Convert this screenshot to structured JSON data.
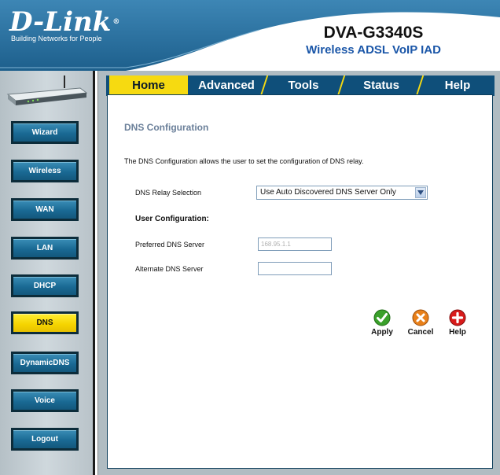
{
  "header": {
    "brand": "D-Link",
    "brand_mark": "®",
    "tagline": "Building Networks for People",
    "model": "DVA-G3340S",
    "model_desc": "Wireless ADSL VoIP IAD",
    "colors": {
      "header_blue": "#2a6e9c",
      "dark_blue": "#0f4f7a",
      "accent_yellow": "#f6da11"
    }
  },
  "sidebar": {
    "image": "router-image",
    "items": [
      {
        "label": "Wizard",
        "active": false
      },
      {
        "label": "Wireless",
        "active": false
      },
      {
        "label": "WAN",
        "active": false
      },
      {
        "label": "LAN",
        "active": false
      },
      {
        "label": "DHCP",
        "active": false
      },
      {
        "label": "DNS",
        "active": true
      },
      {
        "label": "DynamicDNS",
        "active": false
      },
      {
        "label": "Voice",
        "active": false
      },
      {
        "label": "Logout",
        "active": false
      }
    ]
  },
  "tabs": [
    {
      "label": "Home",
      "active": true
    },
    {
      "label": "Advanced",
      "active": false
    },
    {
      "label": "Tools",
      "active": false
    },
    {
      "label": "Status",
      "active": false
    },
    {
      "label": "Help",
      "active": false
    }
  ],
  "content": {
    "title": "DNS Configuration",
    "description": "The DNS Configuration allows the user to set the configuration of DNS relay.",
    "relay_label": "DNS Relay Selection",
    "relay_value": "Use Auto Discovered DNS Server Only",
    "user_config_heading": "User Configuration:",
    "preferred_label": "Preferred DNS Server",
    "preferred_value": "168.95.1.1",
    "alternate_label": "Alternate DNS Server",
    "alternate_value": ""
  },
  "actions": {
    "apply": {
      "label": "Apply",
      "icon": "check-icon",
      "color": "#3aa02a"
    },
    "cancel": {
      "label": "Cancel",
      "icon": "cancel-icon",
      "color": "#e8801a"
    },
    "help": {
      "label": "Help",
      "icon": "plus-icon",
      "color": "#d81b1b"
    }
  }
}
